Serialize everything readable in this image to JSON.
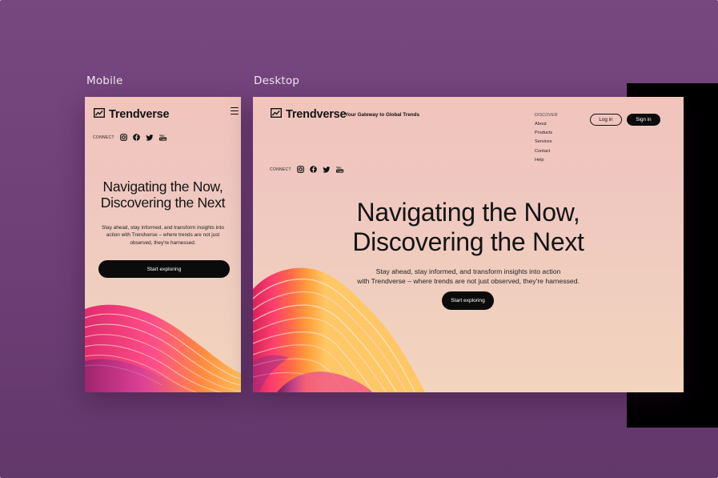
{
  "labels": {
    "mobile": "Mobile",
    "desktop": "Desktop"
  },
  "brand": {
    "name": "Trendverse",
    "tagline": "Your Gateway to Global Trends",
    "logo_icon": "trending-up-chart-icon"
  },
  "connect": {
    "label": "CONNECT",
    "socials": [
      {
        "icon": "instagram-icon"
      },
      {
        "icon": "facebook-icon"
      },
      {
        "icon": "twitter-icon"
      },
      {
        "icon": "youtube-icon"
      }
    ]
  },
  "nav": {
    "heading": "DISCOVER",
    "items": [
      "About",
      "Products",
      "Services",
      "Contact",
      "Help"
    ]
  },
  "auth": {
    "login": "Log in",
    "signup": "Sign in"
  },
  "hero": {
    "title_line1": "Navigating the Now,",
    "title_line2": "Discovering the Next",
    "mobile_subtitle": "Stay ahead, stay informed, and transform insights into action with Trendverse – where trends are not just observed, they're harnessed.",
    "desktop_subtitle_line1": "Stay ahead, stay informed, and transform insights into action",
    "desktop_subtitle_line2": "with Trendverse – where trends are not just observed, they're harnessed.",
    "cta": "Start exploring"
  },
  "colors": {
    "background": "#774780",
    "frame_top": "#f1c4bc",
    "frame_bottom": "#f3d4be",
    "button": "#0b0b0b",
    "wave_colors": [
      "#ff8a3d",
      "#ff4f6e",
      "#e83a8f",
      "#b0329a",
      "#ffb35a"
    ]
  }
}
